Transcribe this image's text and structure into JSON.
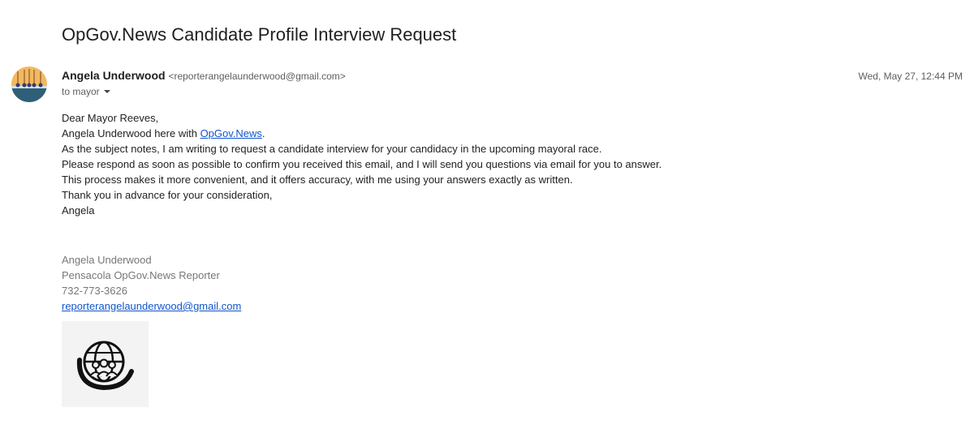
{
  "email": {
    "subject": "OpGov.News Candidate Profile Interview Request",
    "sender_name": "Angela Underwood",
    "sender_email": "<reporterangelaunderwood@gmail.com>",
    "to_label": "to mayor",
    "date": "Wed, May 27, 12:44 PM",
    "avatar_icon": "sender-avatar-image",
    "body": {
      "greeting": "Dear Mayor Reeves,",
      "intro_prefix": "Angela Underwood here with ",
      "intro_link": "OpGov.News",
      "intro_suffix": ".",
      "line1": "As the subject notes, I am writing to request a candidate interview for your candidacy in the upcoming mayoral race.",
      "line2": "Please respond as soon as possible to confirm you received this email, and I will send you questions via email for you to answer.",
      "line3": "This process makes it more convenient, and it offers accuracy, with me using your answers exactly as written.",
      "line4": "Thank you in advance for your consideration,",
      "signoff": "Angela"
    },
    "signature": {
      "name": "Angela Underwood",
      "title": "Pensacola OpGov.News Reporter",
      "phone": "732-773-3626",
      "email_link": "reporterangelaunderwood@gmail.com",
      "logo_icon": "globe-people-logo"
    }
  },
  "colors": {
    "link": "#1155cc",
    "signature_text": "#777777",
    "muted": "#5e5e5e",
    "avatar_bg": "#f4b860",
    "avatar_water": "#2f5f78"
  }
}
